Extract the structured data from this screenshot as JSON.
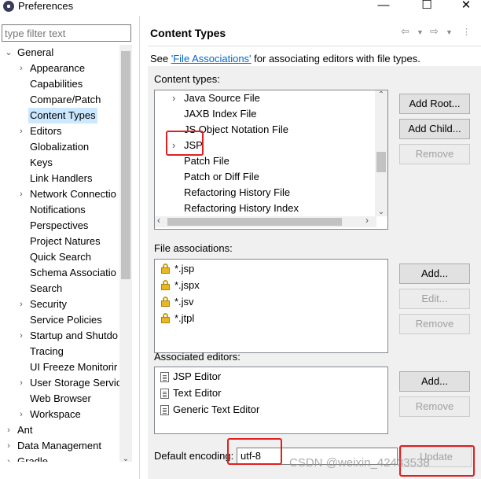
{
  "window": {
    "title": "Preferences",
    "minimize": "—",
    "maximize": "☐",
    "close": "✕"
  },
  "filter": {
    "placeholder": "type filter text"
  },
  "tree": [
    {
      "label": "General",
      "indent": 0,
      "arrow": "⌄"
    },
    {
      "label": "Appearance",
      "indent": 1,
      "arrow": "›"
    },
    {
      "label": "Capabilities",
      "indent": 1,
      "arrow": ""
    },
    {
      "label": "Compare/Patch",
      "indent": 1,
      "arrow": ""
    },
    {
      "label": "Content Types",
      "indent": 1,
      "arrow": "",
      "selected": true
    },
    {
      "label": "Editors",
      "indent": 1,
      "arrow": "›"
    },
    {
      "label": "Globalization",
      "indent": 1,
      "arrow": ""
    },
    {
      "label": "Keys",
      "indent": 1,
      "arrow": ""
    },
    {
      "label": "Link Handlers",
      "indent": 1,
      "arrow": ""
    },
    {
      "label": "Network Connectio",
      "indent": 1,
      "arrow": "›"
    },
    {
      "label": "Notifications",
      "indent": 1,
      "arrow": ""
    },
    {
      "label": "Perspectives",
      "indent": 1,
      "arrow": ""
    },
    {
      "label": "Project Natures",
      "indent": 1,
      "arrow": ""
    },
    {
      "label": "Quick Search",
      "indent": 1,
      "arrow": ""
    },
    {
      "label": "Schema Associatio",
      "indent": 1,
      "arrow": ""
    },
    {
      "label": "Search",
      "indent": 1,
      "arrow": ""
    },
    {
      "label": "Security",
      "indent": 1,
      "arrow": "›"
    },
    {
      "label": "Service Policies",
      "indent": 1,
      "arrow": ""
    },
    {
      "label": "Startup and Shutdo",
      "indent": 1,
      "arrow": "›"
    },
    {
      "label": "Tracing",
      "indent": 1,
      "arrow": ""
    },
    {
      "label": "UI Freeze Monitorir",
      "indent": 1,
      "arrow": ""
    },
    {
      "label": "User Storage Servic",
      "indent": 1,
      "arrow": "›"
    },
    {
      "label": "Web Browser",
      "indent": 1,
      "arrow": ""
    },
    {
      "label": "Workspace",
      "indent": 1,
      "arrow": "›"
    },
    {
      "label": "Ant",
      "indent": 0,
      "arrow": "›"
    },
    {
      "label": "Data Management",
      "indent": 0,
      "arrow": "›"
    },
    {
      "label": "Gradle",
      "indent": 0,
      "arrow": "›"
    }
  ],
  "page": {
    "title": "Content Types",
    "see_prefix": "See ",
    "see_link": "'File Associations'",
    "see_suffix": " for associating editors with file types."
  },
  "content_types": {
    "label": "Content types:",
    "items": [
      {
        "label": "Java Source File",
        "arrow": "›"
      },
      {
        "label": "JAXB Index File",
        "arrow": ""
      },
      {
        "label": "JS Object Notation File",
        "arrow": ""
      },
      {
        "label": "JSP",
        "arrow": "›"
      },
      {
        "label": "Patch File",
        "arrow": ""
      },
      {
        "label": "Patch or Diff File",
        "arrow": ""
      },
      {
        "label": "Refactoring History File",
        "arrow": ""
      },
      {
        "label": "Refactoring History Index",
        "arrow": ""
      }
    ],
    "add_root": "Add Root...",
    "add_child": "Add Child...",
    "remove": "Remove"
  },
  "file_associations": {
    "label": "File associations:",
    "items": [
      "*.jsp",
      "*.jspx",
      "*.jsv",
      "*.jtpl"
    ],
    "add": "Add...",
    "edit": "Edit...",
    "remove": "Remove"
  },
  "associated_editors": {
    "label": "Associated editors:",
    "items": [
      "JSP Editor",
      "Text Editor",
      "Generic Text Editor"
    ],
    "add": "Add...",
    "remove": "Remove"
  },
  "encoding": {
    "label": "Default encoding:",
    "value": "utf-8",
    "update": "Update"
  },
  "watermark": "CSDN @weixin_42433538",
  "colors": {
    "selection": "#cce8ff",
    "link": "#0066cc",
    "highlight_box": "#e02020"
  }
}
